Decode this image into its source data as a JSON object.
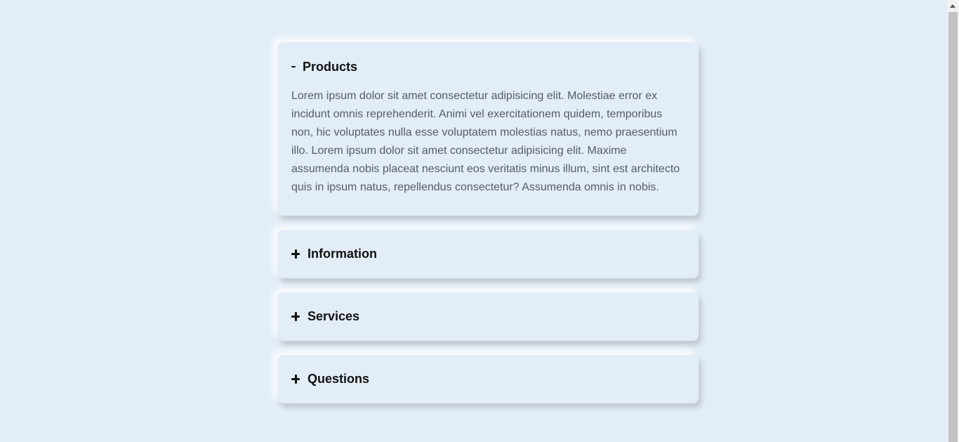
{
  "accordion": {
    "items": [
      {
        "title": "Products",
        "state": "expanded",
        "toggle": "minus-icon",
        "content": "Lorem ipsum dolor sit amet consectetur adipisicing elit. Molestiae error ex incidunt omnis reprehenderit. Animi vel exercitationem quidem, temporibus non, hic voluptates nulla esse voluptatem molestias natus, nemo praesentium illo. Lorem ipsum dolor sit amet consectetur adipisicing elit. Maxime assumenda nobis placeat nesciunt eos veritatis minus illum, sint est architecto quis in ipsum natus, repellendus consectetur? Assumenda omnis in nobis."
      },
      {
        "title": "Information",
        "state": "collapsed",
        "toggle": "plus-icon"
      },
      {
        "title": "Services",
        "state": "collapsed",
        "toggle": "plus-icon"
      },
      {
        "title": "Questions",
        "state": "collapsed",
        "toggle": "plus-icon"
      }
    ]
  },
  "colors": {
    "background": "#e3edf7",
    "title": "#111111",
    "body_text": "#555c66",
    "scrollbar_track": "#f1f1f1",
    "scrollbar_thumb": "#c1c1c1"
  },
  "scrollbar": {
    "icon": "scroll-up-arrow-icon"
  }
}
